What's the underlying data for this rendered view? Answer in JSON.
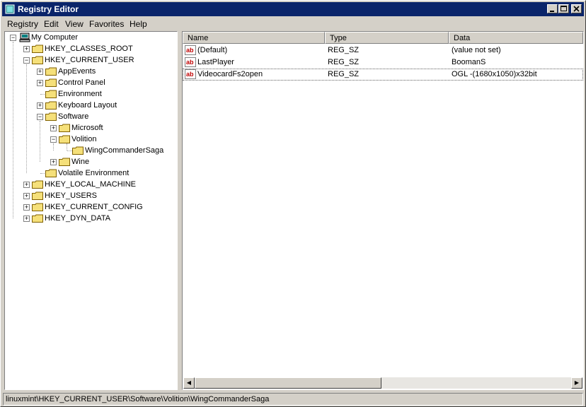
{
  "window": {
    "title": "Registry Editor"
  },
  "menu": {
    "registry": "Registry",
    "edit": "Edit",
    "view": "View",
    "favorites": "Favorites",
    "help": "Help"
  },
  "tree": {
    "root": "My Computer",
    "nodes": [
      "HKEY_CLASSES_ROOT",
      "HKEY_CURRENT_USER",
      "AppEvents",
      "Control Panel",
      "Environment",
      "Keyboard Layout",
      "Software",
      "Microsoft",
      "Volition",
      "WingCommanderSaga",
      "Wine",
      "Volatile Environment",
      "HKEY_LOCAL_MACHINE",
      "HKEY_USERS",
      "HKEY_CURRENT_CONFIG",
      "HKEY_DYN_DATA"
    ]
  },
  "list": {
    "columns": [
      "Name",
      "Type",
      "Data"
    ],
    "rows": [
      {
        "name": "(Default)",
        "type": "REG_SZ",
        "data": "(value not set)"
      },
      {
        "name": "LastPlayer",
        "type": "REG_SZ",
        "data": "BoomanS"
      },
      {
        "name": "VideocardFs2open",
        "type": "REG_SZ",
        "data": "OGL -(1680x1050)x32bit"
      }
    ]
  },
  "status": {
    "path": "linuxmint\\HKEY_CURRENT_USER\\Software\\Volition\\WingCommanderSaga"
  },
  "colors": {
    "titlebar": "#0a246a",
    "chrome": "#d4d0c8",
    "folder": "#f5e07a"
  },
  "icons": [
    "registry-editor-icon",
    "computer-icon",
    "folder-icon",
    "string-value-icon"
  ]
}
